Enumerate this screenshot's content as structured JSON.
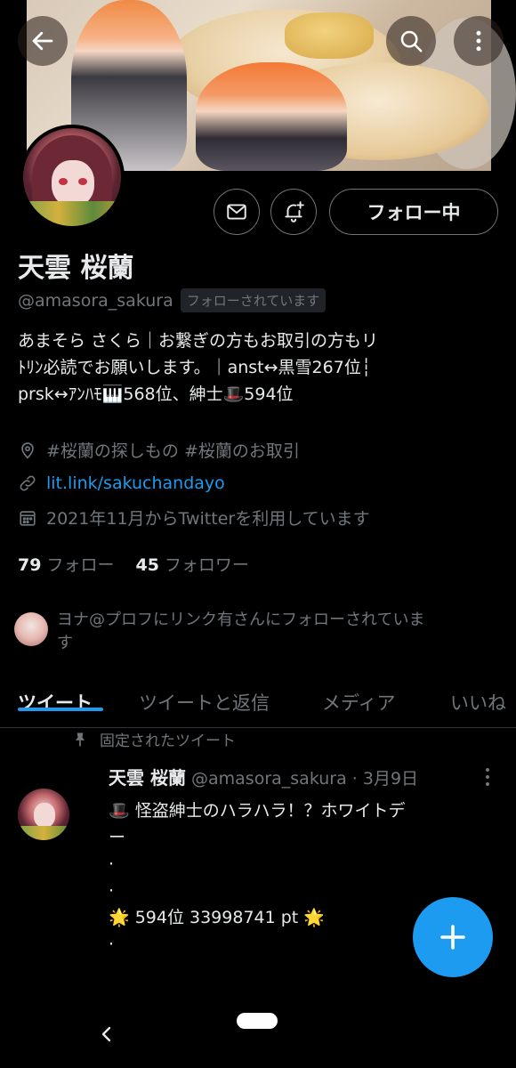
{
  "header": {
    "back_icon": "arrow-left-icon",
    "search_icon": "search-icon",
    "more_icon": "more-vertical-icon"
  },
  "profile": {
    "name": "天雲 桜蘭",
    "handle": "@amasora_sakura",
    "follows_you_badge": "フォローされています",
    "follow_button": "フォロー中",
    "bio_lines": [
      "あまそら さくら｜お繋ぎの方もお取引の方もリ",
      "ﾄﾘﾝ必読でお願いします。｜anst↔黒雪267位┆",
      "prsk↔ｱﾝﾊﾓ🎹568位、紳士🎩594位"
    ],
    "location": "#桜蘭の探しもの #桜蘭のお取引",
    "link": "lit.link/sakuchandayo",
    "joined": "2021年11月からTwitterを利用しています",
    "following_count": "79",
    "following_label": "フォロー",
    "followers_count": "45",
    "followers_label": "フォロワー",
    "followed_by_line1": "ヨナ@プロフにリンク有さんにフォローされていま",
    "followed_by_line2": "す"
  },
  "tabs": [
    {
      "label": "ツイート",
      "active": true
    },
    {
      "label": "ツイートと返信",
      "active": false
    },
    {
      "label": "メディア",
      "active": false
    },
    {
      "label": "いいね",
      "active": false
    }
  ],
  "pinned_tweet": {
    "pinned_label": "固定されたツイート",
    "author_name": "天雲 桜蘭",
    "author_meta": "@amasora_sakura · 3月9日",
    "lines": [
      "🎩 怪盗紳士のハラハラ！？ホワイトデ",
      "ー",
      "·",
      "·",
      "🌟 594位  33998741 pt 🌟",
      "·"
    ]
  },
  "fab": {
    "icon": "plus-icon"
  },
  "colors": {
    "background": "#000000",
    "accent": "#1d9bf0",
    "text_primary": "#e7e9ea",
    "text_secondary": "#71767b",
    "border": "#2f3336"
  }
}
